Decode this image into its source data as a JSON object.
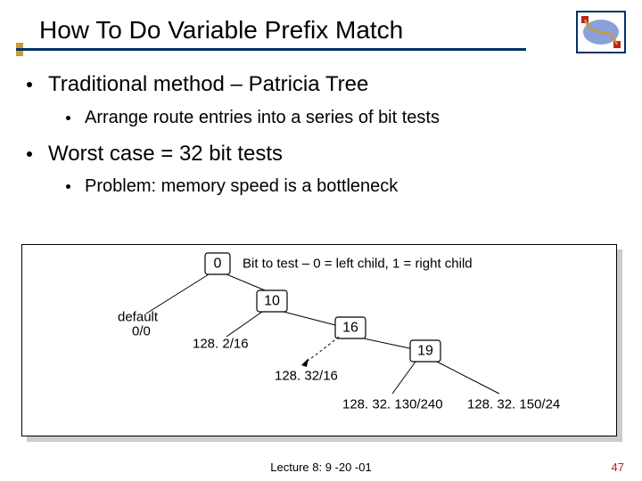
{
  "title": "How To Do Variable Prefix Match",
  "bullets": {
    "b1": "Traditional method – Patricia Tree",
    "b1a": "Arrange route entries into a series of bit tests",
    "b2": "Worst case = 32 bit tests",
    "b2a": "Problem: memory speed is a bottleneck"
  },
  "diagram": {
    "caption": "Bit to test – 0 = left child, 1 = right child",
    "nodes": {
      "n0": "0",
      "n10": "10",
      "n16": "16",
      "n19": "19"
    },
    "labels": {
      "default1": "default",
      "default2": "0/0",
      "l1": "128. 2/16",
      "l2": "128. 32/16",
      "l3": "128. 32. 130/240",
      "l4": "128. 32. 150/24"
    }
  },
  "footer": {
    "center": "Lecture 8: 9 -20 -01",
    "page": "47"
  }
}
